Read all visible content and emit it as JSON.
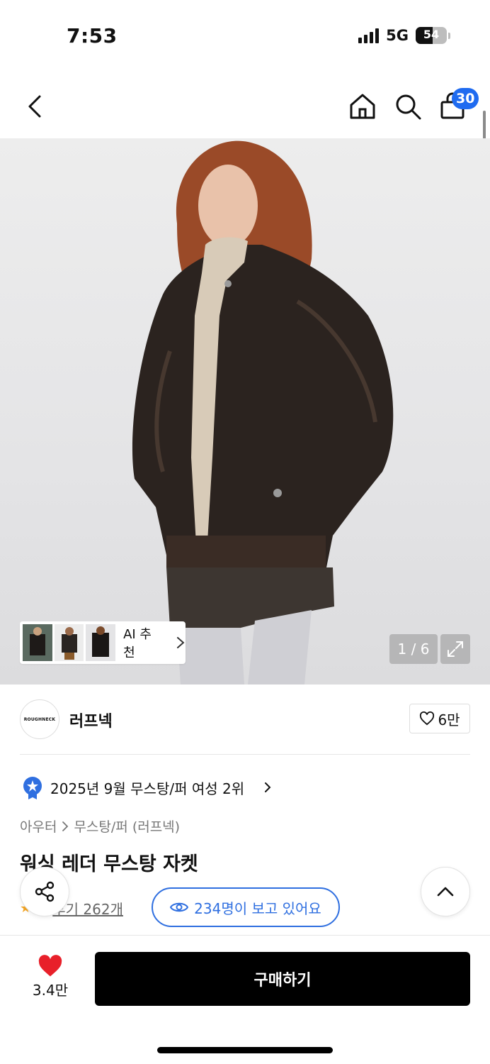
{
  "status_bar": {
    "time": "7:53",
    "network": "5G",
    "battery": "54",
    "battery_level": 0.54
  },
  "header": {
    "cart_count": "30"
  },
  "gallery": {
    "ai_label": "AI 추천",
    "counter": "1 / 6"
  },
  "brand": {
    "logo_text": "ROUGHNECK",
    "name": "러프넥",
    "likes": "6만"
  },
  "ranking": {
    "text": "2025년 9월 무스탕/퍼 여성 2위"
  },
  "breadcrumb": {
    "category": "아우터",
    "subcategory": "무스탕/퍼 (러프넥)"
  },
  "product": {
    "title": "워싱 레더 무스탕 자켓"
  },
  "rating": {
    "score": "5",
    "reviews": "후기 262개"
  },
  "viewers": {
    "text": "234명이 보고 있어요"
  },
  "bottom": {
    "likes": "3.4만",
    "buy_label": "구매하기"
  },
  "colors": {
    "accent": "#2f6fe0",
    "badge": "#1f6bf0",
    "heart": "#e8202a",
    "buy": "#000000"
  }
}
